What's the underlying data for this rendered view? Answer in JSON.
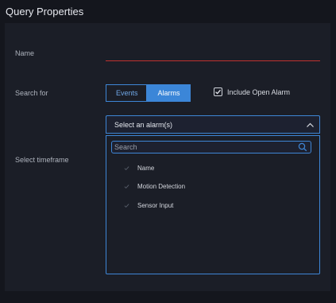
{
  "panel": {
    "title": "Query Properties"
  },
  "form": {
    "name_label": "Name",
    "search_for_label": "Search for",
    "timeframe_label": "Select timeframe"
  },
  "search_for": {
    "events_label": "Events",
    "alarms_label": "Alarms",
    "selected": "Alarms",
    "include_open_alarm_label": "Include Open Alarm",
    "include_open_alarm_checked": true
  },
  "alarm_select": {
    "placeholder": "Select an alarm(s)",
    "search_placeholder": "Search",
    "options": [
      {
        "label": "Name"
      },
      {
        "label": "Motion Detection"
      },
      {
        "label": "Sensor Input"
      }
    ]
  },
  "colors": {
    "background": "#14161d",
    "accent": "#3b86d8",
    "error_line": "#c0322f"
  },
  "icons": {
    "checkbox": "check-icon",
    "select": "chevron-up-icon",
    "search": "search-icon",
    "option": "tick-icon"
  }
}
